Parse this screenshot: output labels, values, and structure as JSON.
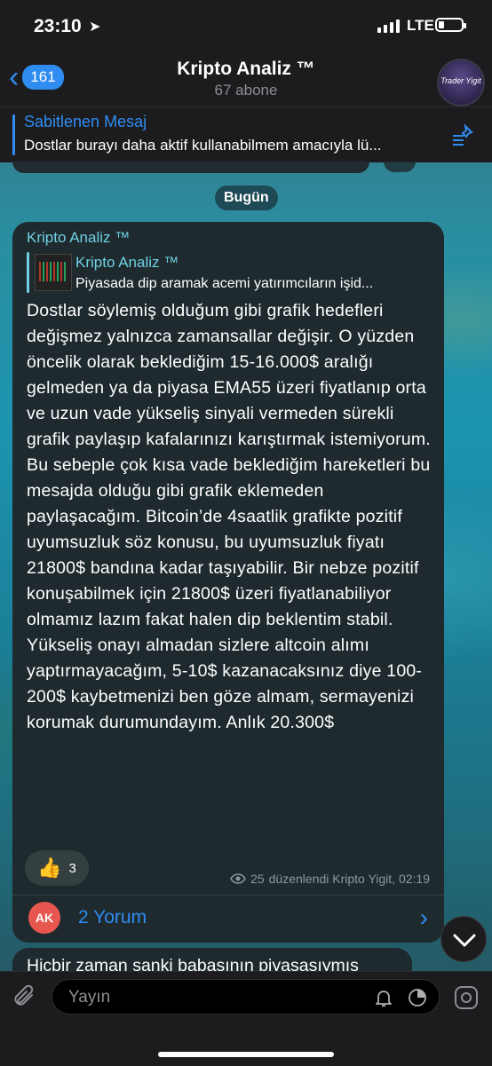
{
  "status": {
    "time": "23:10",
    "network": "LTE"
  },
  "header": {
    "back_count": "161",
    "title": "Kripto Analiz ™",
    "subtitle": "67 abone",
    "avatar_text": "Trader Yigit"
  },
  "pinned": {
    "title": "Sabitlenen Mesaj",
    "text": "Dostlar burayı daha aktif kullanabilmem amacıyla lü..."
  },
  "date_separator": "Bugün",
  "message": {
    "author": "Kripto Analiz ™",
    "forwarded": {
      "name": "Kripto Analiz ™",
      "text": "Piyasada dip aramak acemi yatırımcıların işid..."
    },
    "body": "Dostlar söylemiş olduğum gibi grafik hedefleri değişmez yalnızca zamansallar değişir. O yüzden öncelik olarak beklediğim 15-16.000$ aralığı gelmeden ya da piyasa EMA55 üzeri fiyatlanıp orta ve uzun vade yükseliş sinyali vermeden sürekli grafik paylaşıp kafalarınızı karıştırmak istemiyorum. Bu sebeple çok kısa vade beklediğim hareketleri bu mesajda olduğu gibi grafik eklemeden paylaşacağım. Bitcoin’de 4saatlik grafikte pozitif uyumsuzluk söz konusu, bu uyumsuzluk fiyatı 21800$ bandına kadar taşıyabilir. Bir nebze pozitif konuşabilmek için 21800$ üzeri fiyatlanabiliyor olmamız lazım fakat halen dip beklentim stabil. Yükseliş onayı almadan sizlere altcoin alımı yaptırmayacağım, 5-10$ kazanacaksınız diye 100-200$ kaybetmenizi ben göze almam, sermayenizi korumak durumundayım. Anlık 20.300$",
    "reaction": {
      "emoji": "👍",
      "count": "3"
    },
    "views": "25",
    "meta": "düzenlendi Kripto Yigit, 02:19",
    "comments": {
      "avatar_initials": "AK",
      "label": "2 Yorum"
    }
  },
  "next_message_preview": "Hiçbir zaman sanki babasının piyasasıymış",
  "input": {
    "placeholder": "Yayın"
  },
  "icons": [
    "location-arrow-icon",
    "signal-icon",
    "battery-icon",
    "chevron-left-icon",
    "pin-list-icon",
    "eye-icon",
    "chevron-right-icon",
    "chevron-down-icon",
    "paperclip-icon",
    "bell-icon",
    "timer-icon",
    "camera-icon"
  ],
  "colors": {
    "accent": "#2f8cf0",
    "channel_name": "#6fd0e4",
    "bubble": "#1e2a2e",
    "bar": "#1c1c1e"
  }
}
